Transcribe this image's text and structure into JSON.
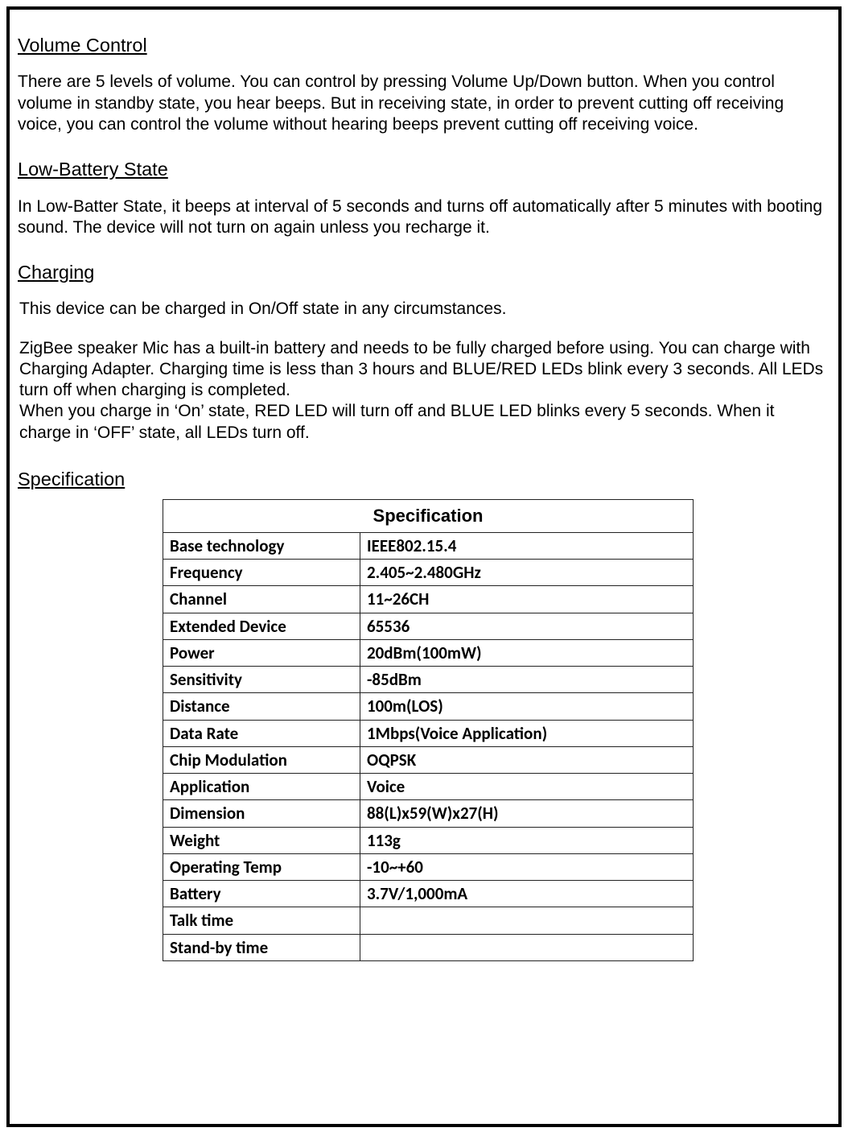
{
  "sections": {
    "volume": {
      "heading": "Volume Control",
      "body": "There are 5 levels of volume. You can control by pressing Volume Up/Down button. When you control volume in standby state, you hear beeps.  But in receiving state, in order to prevent cutting off receiving voice, you can control the volume without hearing beeps  prevent cutting off receiving voice."
    },
    "lowbat": {
      "heading": "Low-Battery State",
      "body": "In Low-Batter State, it beeps at interval of  5 seconds and turns off automatically after 5 minutes with booting sound. The device will not turn on again unless you recharge it."
    },
    "charging": {
      "heading": "Charging",
      "body1": "This device can be charged in On/Off state in any circumstances.",
      "body2": "ZigBee speaker Mic has a built-in battery and needs to be fully charged before using. You can charge with Charging Adapter. Charging time is less than 3 hours and BLUE/RED LEDs blink every 3 seconds. All LEDs turn off when charging is completed.",
      "body3": "When you charge in ‘On’ state, RED LED will turn off and BLUE LED blinks every 5 seconds. When it charge in ‘OFF’ state, all LEDs turn off."
    },
    "spec": {
      "heading": "Specification",
      "table_title": "Specification",
      "rows": [
        {
          "label": "Base technology",
          "value": "IEEE802.15.4"
        },
        {
          "label": "Frequency",
          "value": "2.405~2.480GHz"
        },
        {
          "label": "Channel",
          "value": "11~26CH"
        },
        {
          "label": "Extended Device",
          "value": "65536"
        },
        {
          "label": "Power",
          "value": "20dBm(100mW)"
        },
        {
          "label": "Sensitivity",
          "value": " -85dBm"
        },
        {
          "label": "Distance",
          "value": "100m(LOS)"
        },
        {
          "label": "Data Rate",
          "value": "1Mbps(Voice Application)"
        },
        {
          "label": "Chip Modulation",
          "value": "OQPSK"
        },
        {
          "label": "Application",
          "value": "Voice"
        },
        {
          "label": "Dimension",
          "value": "88(L)x59(W)x27(H)"
        },
        {
          "label": "Weight",
          "value": "113g"
        },
        {
          "label": "Operating Temp",
          "value": " -10~+60"
        },
        {
          "label": "Battery",
          "value": "3.7V/1,000mA"
        },
        {
          "label": "Talk time",
          "value": ""
        },
        {
          "label": "Stand-by time",
          "value": ""
        }
      ]
    }
  }
}
